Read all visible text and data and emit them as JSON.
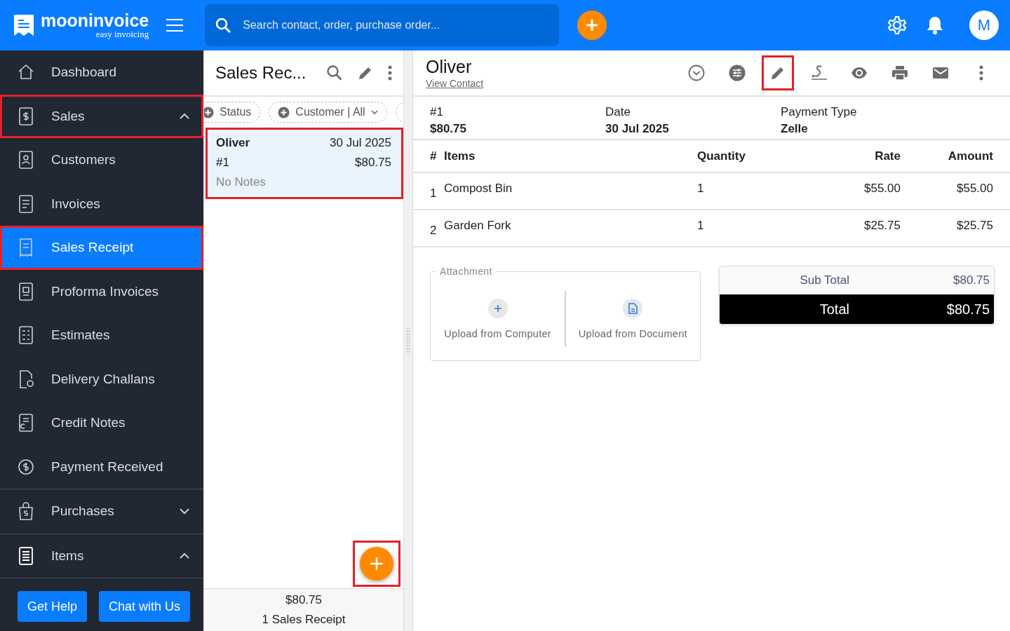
{
  "app": {
    "brand": "mooninvoice",
    "tagline": "easy invoicing",
    "search": {
      "placeholder": "Search contact, order, purchase order..."
    },
    "avatar": "M"
  },
  "sidebar": {
    "items": [
      {
        "label": "Dashboard",
        "selected": false,
        "highlighted": false
      },
      {
        "label": "Sales",
        "selected": false,
        "highlighted": true,
        "expanded": true,
        "children": [
          {
            "label": "Customers",
            "selected": false,
            "highlighted": false
          },
          {
            "label": "Invoices",
            "selected": false,
            "highlighted": false
          },
          {
            "label": "Sales Receipt",
            "selected": true,
            "highlighted": true
          },
          {
            "label": "Proforma Invoices",
            "selected": false,
            "highlighted": false
          },
          {
            "label": "Estimates",
            "selected": false,
            "highlighted": false
          },
          {
            "label": "Delivery Challans",
            "selected": false,
            "highlighted": false
          },
          {
            "label": "Credit Notes",
            "selected": false,
            "highlighted": false
          },
          {
            "label": "Payment Received",
            "selected": false,
            "highlighted": false
          }
        ]
      },
      {
        "label": "Purchases",
        "selected": false,
        "highlighted": false,
        "expanded": false
      },
      {
        "label": "Items",
        "selected": false,
        "highlighted": false,
        "expanded": true
      }
    ],
    "buttons": [
      "Get Help",
      "Chat with Us"
    ]
  },
  "list": {
    "title": "Sales Rec...",
    "filters": [
      {
        "label": "Status",
        "dropdown": false
      },
      {
        "label": "Customer | All",
        "dropdown": true
      }
    ],
    "receipts": [
      {
        "name": "Oliver",
        "date": "30 Jul 2025",
        "number": "#1",
        "amount": "$80.75",
        "notes": "No Notes",
        "selected": true,
        "highlighted": true
      }
    ],
    "fab": {
      "highlighted": true
    },
    "total": "$80.75",
    "count": "1 Sales Receipt"
  },
  "detail": {
    "customer": "Oliver",
    "link": "View Contact",
    "toolbar": [
      {
        "highlighted": false
      },
      {
        "highlighted": false
      },
      {
        "highlighted": true
      },
      {
        "highlighted": false
      },
      {
        "highlighted": false
      },
      {
        "highlighted": false
      },
      {
        "highlighted": false
      },
      {
        "highlighted": false
      }
    ],
    "info": [
      {
        "label": "#1",
        "value": "$80.75"
      },
      {
        "label": "Date",
        "value": "30 Jul 2025"
      },
      {
        "label": "Payment Type",
        "value": "Zelle"
      }
    ],
    "table": {
      "columns": [
        "#",
        "Items",
        "Quantity",
        "Rate",
        "Amount"
      ],
      "rows": [
        [
          "1",
          "Compost Bin",
          "1",
          "$55.00",
          "$55.00"
        ],
        [
          "2",
          "Garden Fork",
          "1",
          "$25.75",
          "$25.75"
        ]
      ]
    },
    "attachment": {
      "legend": "Attachment",
      "options": [
        "Upload from Computer",
        "Upload from Document"
      ]
    },
    "totals": {
      "sub_total_label": "Sub Total",
      "sub_total": "$80.75",
      "total_label": "Total",
      "total": "$80.75"
    }
  }
}
